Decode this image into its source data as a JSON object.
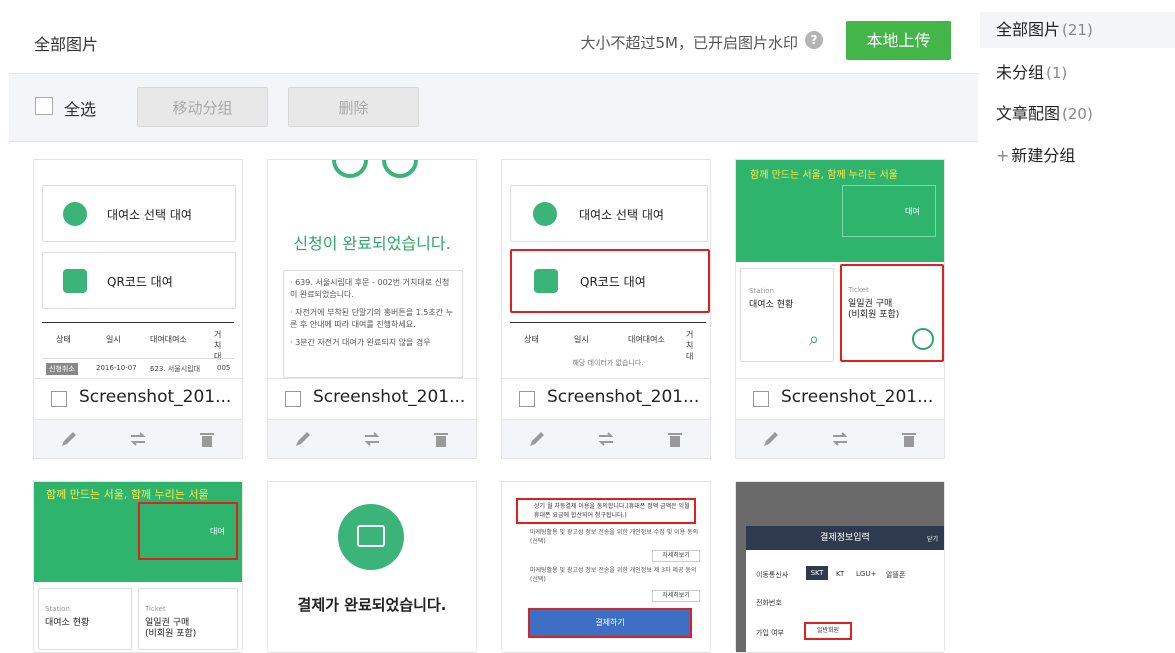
{
  "header": {
    "title": "全部图片",
    "hint": "大小不超过5M，已开启图片水印",
    "help_glyph": "?",
    "upload_label": "本地上传"
  },
  "toolbar": {
    "select_all": "全选",
    "move_group": "移动分组",
    "delete": "删除"
  },
  "sidebar": {
    "items": [
      {
        "label": "全部图片",
        "count": "(21)"
      },
      {
        "label": "未分组",
        "count": "(1)"
      },
      {
        "label": "文章配图",
        "count": "(20)"
      }
    ],
    "new_group": "新建分组",
    "new_group_plus": "+"
  },
  "thumbs": {
    "rental_station": "대여소 선택 대여",
    "qr_rental": "QR코드 대여",
    "col_status": "상태",
    "col_date": "일시",
    "col_station": "대여대여소",
    "col_return": "거치대",
    "row_status": "신청취소",
    "row_date": "2016-10-07",
    "row_station": "623. 서울시립대",
    "row_return": "005",
    "no_data": "해당 데이터가 없습니다.",
    "apply_done": "신청이 완료되었습니다.",
    "apply_note1": "· 639. 서울시립대 후문 - 002번 거치대로 신청이 완료되었습니다.",
    "apply_note2": "· 자전거에 부착된 단말기의 홍버튼을 1.5초간 누른 후 안내에 따라 대여를 진행하세요.",
    "apply_note3": "· 3분간 자전거 대여가 완료되지 않을 경우",
    "slogan": "함께 만드는 서울, 함께 누리는 서울",
    "rent": "대여",
    "station_en": "Station",
    "station_status": "대여소 현황",
    "ticket_en": "Ticket",
    "ticket_buy": "일일권 구매",
    "ticket_sub": "(비회원 포함)",
    "pay_done": "결제가 완료되었습니다.",
    "terms1": "상기 월 자동결제 이용을 동의합니다.(휴대폰 정액 금액은 익월 휴대폰 요금에 합산되어 청구됩니다.)",
    "terms2": "마케팅활용 및 광고성 정보 전송을 위한 개인정보 수집 및 이용 동의(선택)",
    "terms3": "마케팅활용 및 광고성 정보 전송을 위한 개인정보 제 3자 제공 동의(선택)",
    "detail": "자세히보기",
    "pay_btn": "결제하기",
    "pay_info": "결제정보입력",
    "close": "닫기",
    "carrier": "이동통신사",
    "skt": "SKT",
    "kt": "KT",
    "lgu": "LGU+",
    "budget": "알뜰폰",
    "phone": "전화번호",
    "join": "가입 여부",
    "general": "일반회원"
  },
  "cards": [
    {
      "name": "Screenshot_201..."
    },
    {
      "name": "Screenshot_201..."
    },
    {
      "name": "Screenshot_201..."
    },
    {
      "name": "Screenshot_201..."
    }
  ],
  "colors": {
    "accent": "#44b549",
    "highlight": "#e02020",
    "panel": "#f4f5f9"
  }
}
